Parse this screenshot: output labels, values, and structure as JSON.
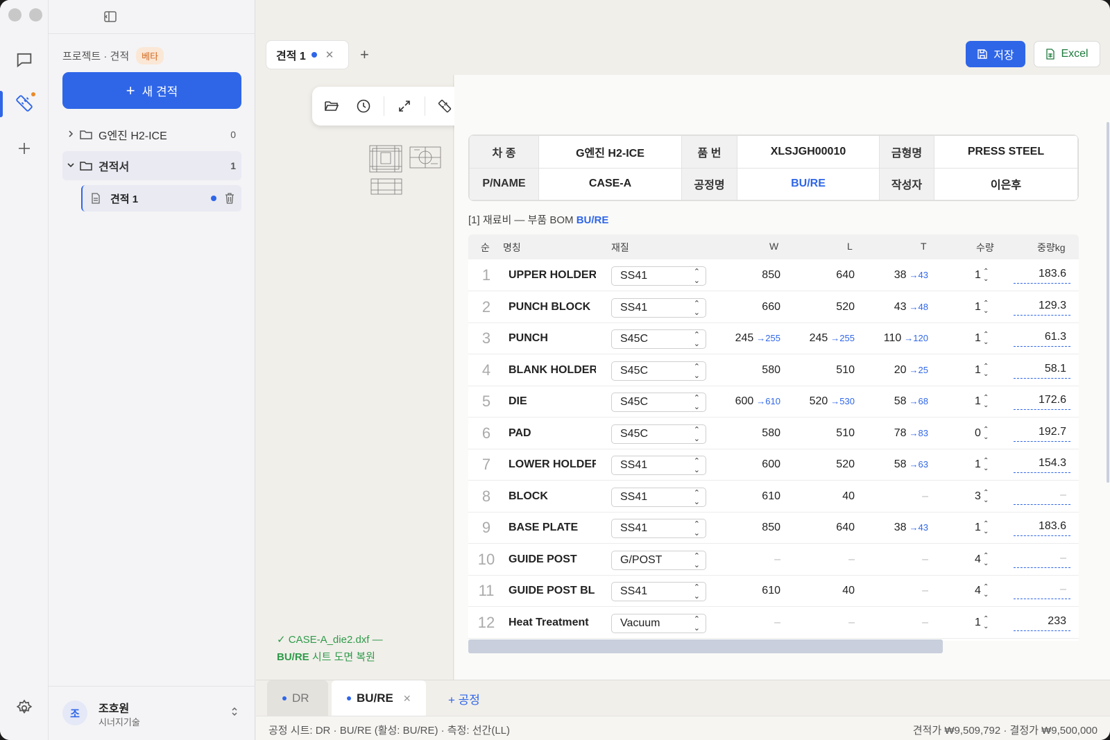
{
  "sidebar": {
    "breadcrumb": "프로젝트 · 견적",
    "beta": "베타",
    "new_button": "새 견적",
    "tree": [
      {
        "label": "G엔진 H2-ICE",
        "count": "0",
        "chevron": "›"
      },
      {
        "label": "견적서",
        "count": "1",
        "chevron": "⌄"
      }
    ],
    "file": {
      "label": "견적 1"
    },
    "user": {
      "initial": "조",
      "name": "조호원",
      "org": "시너지기술"
    }
  },
  "tabs": {
    "doc_tab": "견적 1",
    "save_label": "저장",
    "excel_label": "Excel"
  },
  "info": {
    "labels": [
      "차 종",
      "품 번",
      "금형명",
      "P/NAME",
      "공정명",
      "작성자"
    ],
    "car_type": "G엔진 H2-ICE",
    "part_no": "XLSJGH00010",
    "die_name": "PRESS STEEL",
    "p_name": "CASE-A",
    "process": "BU/RE",
    "author": "이은후"
  },
  "section": {
    "title": "[1] 재료비 — 부품 BOM",
    "process": "BU/RE"
  },
  "bom_headers": [
    "순",
    "명칭",
    "재질",
    "W",
    "L",
    "T",
    "수량",
    "중량kg"
  ],
  "bom_rows": [
    {
      "no": "1",
      "name": "UPPER HOLDER",
      "mat": "SS41",
      "w": "850",
      "w_to": "",
      "l": "640",
      "l_to": "",
      "t": "38",
      "t_to": "→43",
      "qty": "1",
      "wt": "183.6"
    },
    {
      "no": "2",
      "name": "PUNCH BLOCK",
      "mat": "SS41",
      "w": "660",
      "w_to": "",
      "l": "520",
      "l_to": "",
      "t": "43",
      "t_to": "→48",
      "qty": "1",
      "wt": "129.3"
    },
    {
      "no": "3",
      "name": "PUNCH",
      "mat": "S45C",
      "w": "245",
      "w_to": "→255",
      "l": "245",
      "l_to": "→255",
      "t": "110",
      "t_to": "→120",
      "qty": "1",
      "wt": "61.3"
    },
    {
      "no": "4",
      "name": "BLANK HOLDER",
      "mat": "S45C",
      "w": "580",
      "w_to": "",
      "l": "510",
      "l_to": "",
      "t": "20",
      "t_to": "→25",
      "qty": "1",
      "wt": "58.1"
    },
    {
      "no": "5",
      "name": "DIE",
      "mat": "S45C",
      "w": "600",
      "w_to": "→610",
      "l": "520",
      "l_to": "→530",
      "t": "58",
      "t_to": "→68",
      "qty": "1",
      "wt": "172.6"
    },
    {
      "no": "6",
      "name": "PAD",
      "mat": "S45C",
      "w": "580",
      "w_to": "",
      "l": "510",
      "l_to": "",
      "t": "78",
      "t_to": "→83",
      "qty": "0",
      "wt": "192.7"
    },
    {
      "no": "7",
      "name": "LOWER HOLDER",
      "mat": "SS41",
      "w": "600",
      "w_to": "",
      "l": "520",
      "l_to": "",
      "t": "58",
      "t_to": "→63",
      "qty": "1",
      "wt": "154.3"
    },
    {
      "no": "8",
      "name": "BLOCK",
      "mat": "SS41",
      "w": "610",
      "w_to": "",
      "l": "40",
      "l_to": "",
      "t": "–",
      "t_to": "",
      "qty": "3",
      "wt": "–"
    },
    {
      "no": "9",
      "name": "BASE PLATE",
      "mat": "SS41",
      "w": "850",
      "w_to": "",
      "l": "640",
      "l_to": "",
      "t": "38",
      "t_to": "→43",
      "qty": "1",
      "wt": "183.6"
    },
    {
      "no": "10",
      "name": "GUIDE POST",
      "mat": "G/POST",
      "w": "–",
      "w_to": "",
      "l": "–",
      "l_to": "",
      "t": "–",
      "t_to": "",
      "qty": "4",
      "wt": "–"
    },
    {
      "no": "11",
      "name": "GUIDE POST BL",
      "mat": "SS41",
      "w": "610",
      "w_to": "",
      "l": "40",
      "l_to": "",
      "t": "–",
      "t_to": "",
      "qty": "4",
      "wt": "–"
    },
    {
      "no": "12",
      "name": "Heat Treatment",
      "mat": "Vacuum",
      "w": "–",
      "w_to": "",
      "l": "–",
      "l_to": "",
      "t": "–",
      "t_to": "",
      "qty": "1",
      "wt": "233"
    }
  ],
  "restore_note": {
    "line1": "✓ CASE-A_die2.dxf —",
    "line2_bold": "BU/RE",
    "line2_rest": " 시트 도면 복원"
  },
  "bottom_tabs": {
    "dr": "DR",
    "bure": "BU/RE",
    "add": "+ 공정"
  },
  "status": {
    "left": "공정 시트: DR · BU/RE (활성: BU/RE) · 측정: 선간(LL)",
    "right": "견적가 ₩9,509,792 · 결정가 ₩9,500,000"
  },
  "colors": {
    "accent": "#2f66e8",
    "success": "#2e9a4a",
    "beta": "#d2691e"
  }
}
